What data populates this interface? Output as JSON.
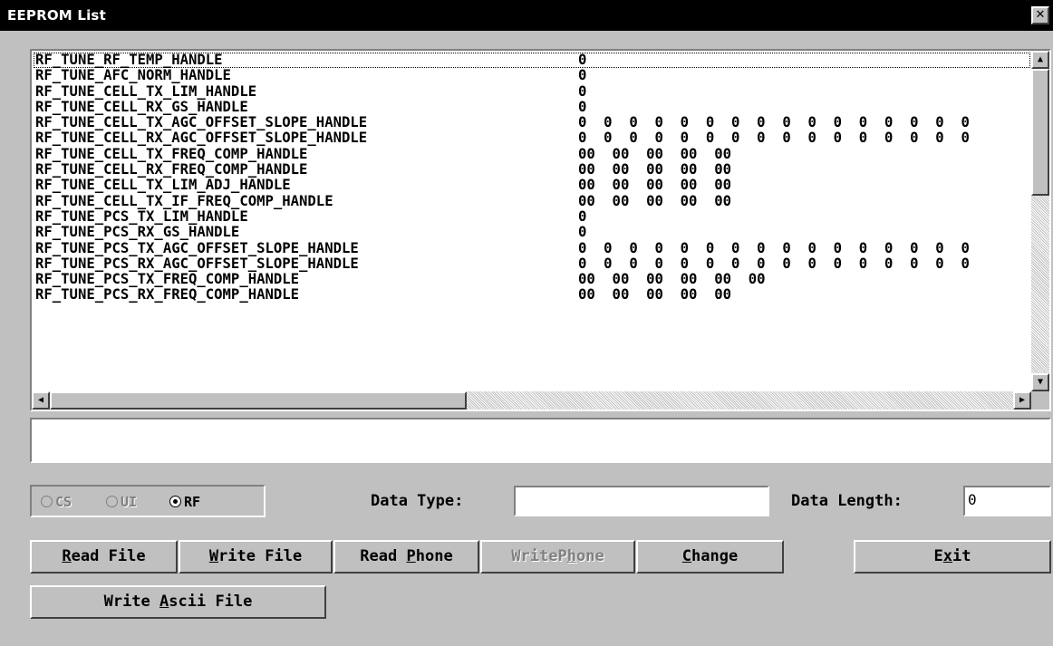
{
  "window": {
    "title": "EEPROM List",
    "close_label": "✕"
  },
  "list": {
    "rows": [
      {
        "name": "RF_TUNE_RF_TEMP_HANDLE",
        "value": "0"
      },
      {
        "name": "RF_TUNE_AFC_NORM_HANDLE",
        "value": "0"
      },
      {
        "name": "RF_TUNE_CELL_TX_LIM_HANDLE",
        "value": "0"
      },
      {
        "name": "RF_TUNE_CELL_RX_GS_HANDLE",
        "value": "0"
      },
      {
        "name": "RF_TUNE_CELL_TX_AGC_OFFSET_SLOPE_HANDLE",
        "value": "0  0  0  0  0  0  0  0  0  0  0  0  0  0  0  0"
      },
      {
        "name": "RF_TUNE_CELL_RX_AGC_OFFSET_SLOPE_HANDLE",
        "value": "0  0  0  0  0  0  0  0  0  0  0  0  0  0  0  0"
      },
      {
        "name": "RF_TUNE_CELL_TX_FREQ_COMP_HANDLE",
        "value": "00  00  00  00  00"
      },
      {
        "name": "RF_TUNE_CELL_RX_FREQ_COMP_HANDLE",
        "value": "00  00  00  00  00"
      },
      {
        "name": "RF_TUNE_CELL_TX_LIM_ADJ_HANDLE",
        "value": "00  00  00  00  00"
      },
      {
        "name": "RF_TUNE_CELL_TX_IF_FREQ_COMP_HANDLE",
        "value": "00  00  00  00  00"
      },
      {
        "name": "RF_TUNE_PCS_TX_LIM_HANDLE",
        "value": "0"
      },
      {
        "name": "RF_TUNE_PCS_RX_GS_HANDLE",
        "value": "0"
      },
      {
        "name": "RF_TUNE_PCS_TX_AGC_OFFSET_SLOPE_HANDLE",
        "value": "0  0  0  0  0  0  0  0  0  0  0  0  0  0  0  0"
      },
      {
        "name": "RF_TUNE_PCS_RX_AGC_OFFSET_SLOPE_HANDLE",
        "value": "0  0  0  0  0  0  0  0  0  0  0  0  0  0  0  0"
      },
      {
        "name": "RF_TUNE_PCS_TX_FREQ_COMP_HANDLE",
        "value": "00  00  00  00  00  00"
      },
      {
        "name": "RF_TUNE_PCS_RX_FREQ_COMP_HANDLE",
        "value": "00  00  00  00  00"
      }
    ],
    "selected_index": 0
  },
  "message": "",
  "radios": [
    {
      "label": "CS",
      "checked": false,
      "disabled": true
    },
    {
      "label": "UI",
      "checked": false,
      "disabled": true
    },
    {
      "label": "RF",
      "checked": true,
      "disabled": false
    }
  ],
  "data_type": {
    "label": "Data Type:",
    "value": ""
  },
  "data_length": {
    "label": "Data Length:",
    "value": "0"
  },
  "buttons": {
    "read_file": {
      "pre": "",
      "u": "R",
      "post": "ead File"
    },
    "write_file": {
      "pre": "",
      "u": "W",
      "post": "rite File"
    },
    "read_phone": {
      "pre": "Read ",
      "u": "P",
      "post": "hone"
    },
    "write_phone": {
      "pre": "WriteP",
      "u": "h",
      "post": "one"
    },
    "change": {
      "pre": "",
      "u": "C",
      "post": "hange"
    },
    "exit": {
      "pre": "E",
      "u": "x",
      "post": "it"
    },
    "write_ascii": {
      "pre": "Write ",
      "u": "A",
      "post": "scii File"
    }
  },
  "icons": {
    "scroll_up": "▲",
    "scroll_down": "▼",
    "scroll_left": "◀",
    "scroll_right": "▶"
  }
}
